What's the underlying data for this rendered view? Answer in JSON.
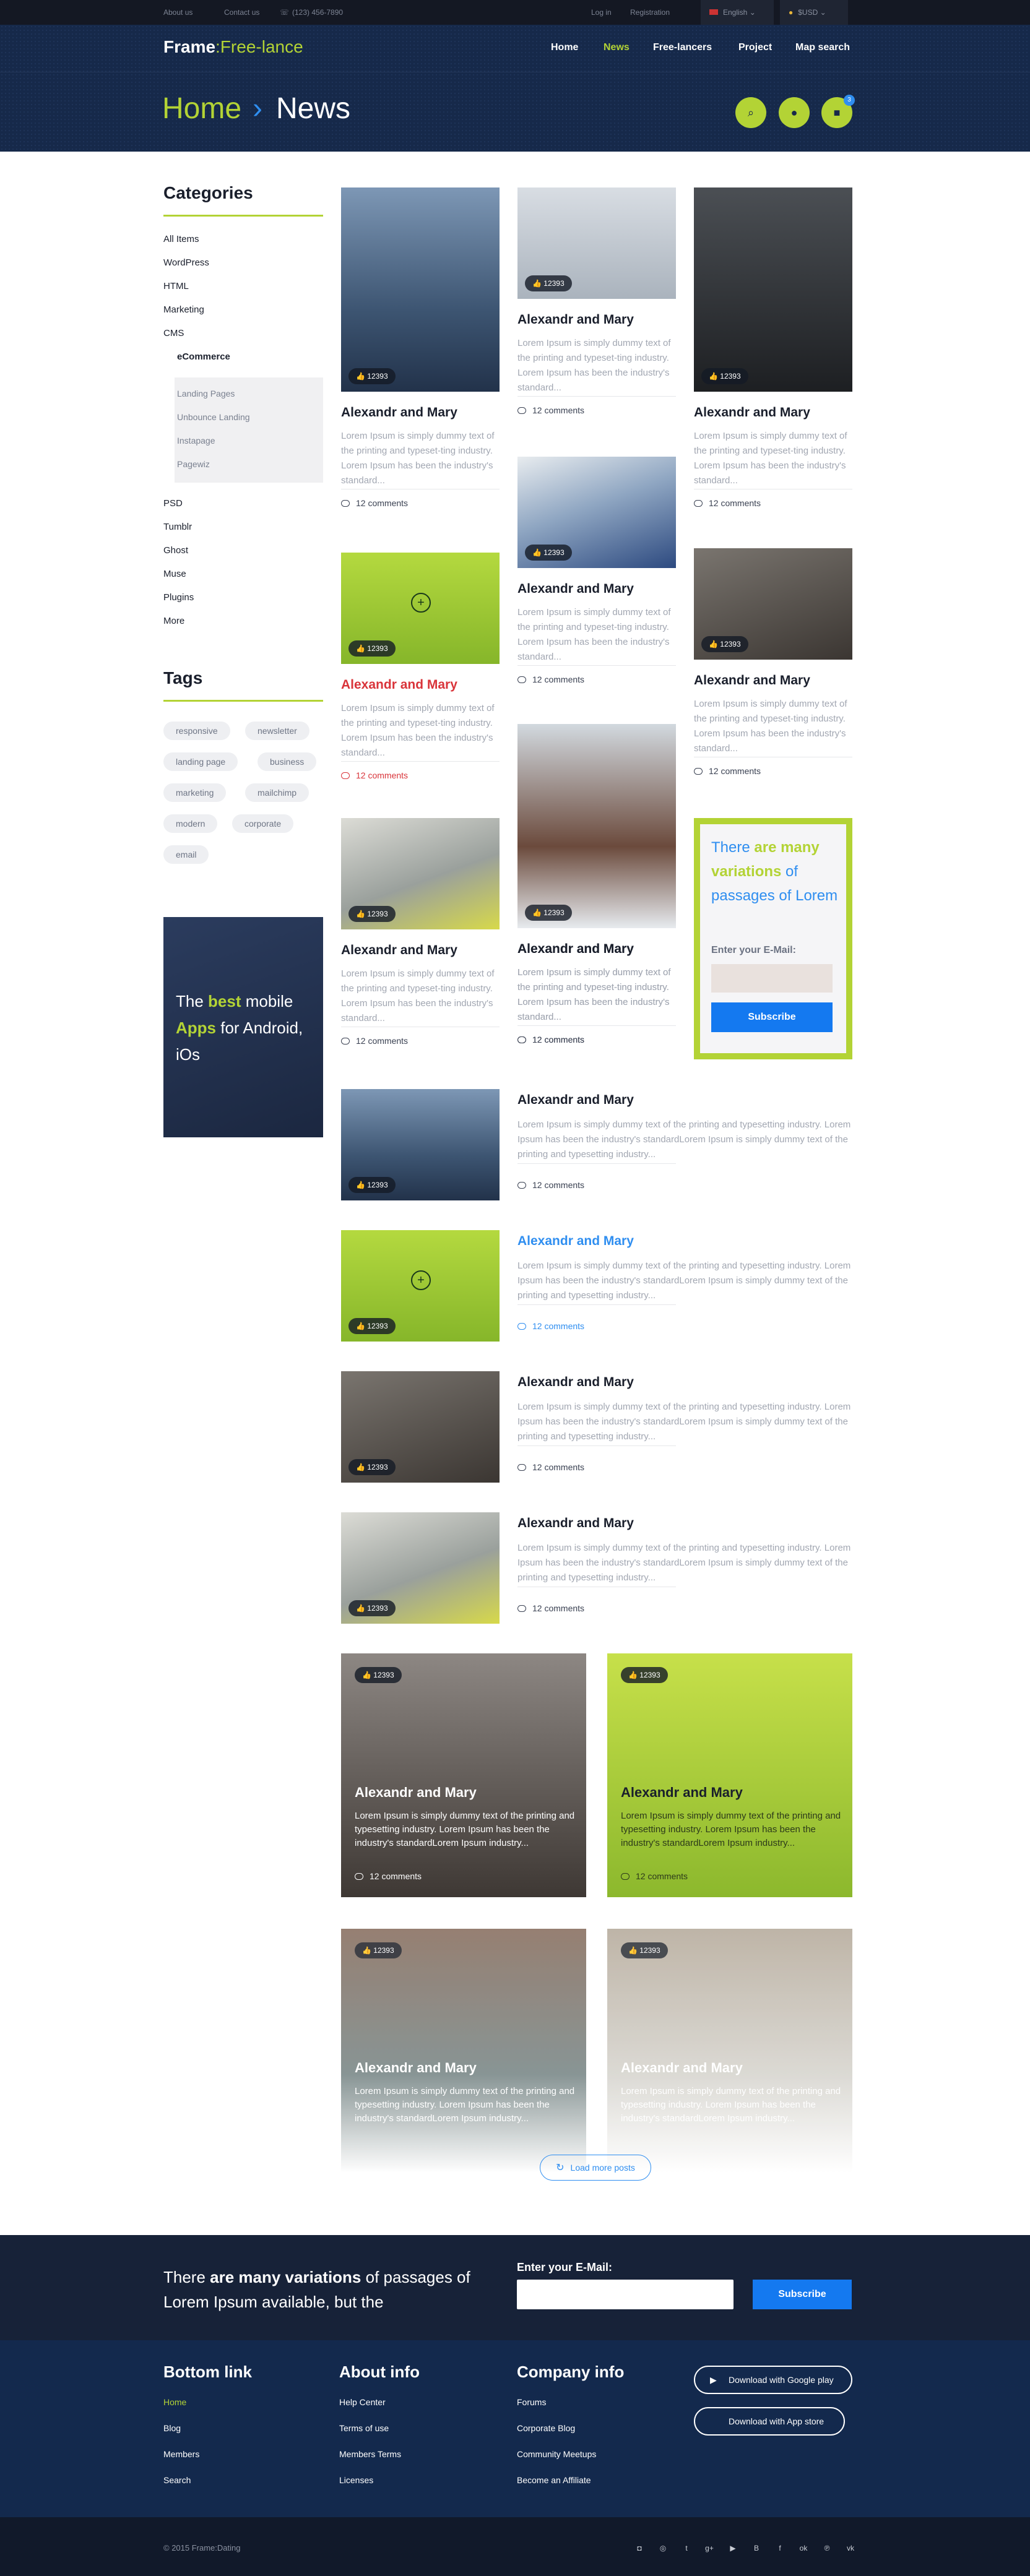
{
  "topbar": {
    "about": "About us",
    "contact": "Contact us",
    "phone": "(123) 456-7890",
    "login": "Log in",
    "registration": "Registration",
    "language": "English",
    "currency": "$USD"
  },
  "header": {
    "logo_a": "Frame",
    "logo_b": ":Free-lance",
    "nav": [
      "Home",
      "News",
      "Free-lancers",
      "Project",
      "Map search"
    ],
    "crumb_home": "Home",
    "crumb_sep": "›",
    "crumb_current": "News",
    "cart_badge": "3"
  },
  "sidebar": {
    "categories_title": "Categories",
    "categories": [
      "All Items",
      "WordPress",
      "HTML",
      "Marketing",
      "CMS",
      "eCommerce"
    ],
    "subcategories": [
      "Landing Pages",
      "Unbounce Landing",
      "Instapage",
      "Pagewiz"
    ],
    "categories_more": [
      "PSD",
      "Tumblr",
      "Ghost",
      "Muse",
      "Plugins",
      "More"
    ],
    "tags_title": "Tags",
    "tags": [
      "responsive",
      "newsletter",
      "landing page",
      "business",
      "marketing",
      "mailchimp",
      "modern",
      "corporate",
      "email"
    ],
    "promo_a": "The ",
    "promo_b": "best",
    "promo_c": " mobile ",
    "promo_d": "Apps",
    "promo_e": " for Android, iOs"
  },
  "card": {
    "title": "Alexandr and Mary",
    "text": "Lorem Ipsum is simply dummy text of the printing and typeset-ting industry. Lorem Ipsum has been the industry's standard...",
    "wide_text": "Lorem Ipsum is simply dummy text of the printing and typesetting industry. Lorem Ipsum has been the industry's standardLorem Ipsum is simply dummy text of the printing and typesetting industry...",
    "big_text": "Lorem Ipsum is simply dummy text of the printing and typesetting industry. Lorem Ipsum has been the industry's standardLorem Ipsum industry...",
    "comments": "12 comments",
    "likes": "12393"
  },
  "newsletter_box": {
    "a": "There ",
    "b": "are many variations",
    "c": " of passages of Lorem",
    "label": "Enter your E-Mail:",
    "button": "Subscribe"
  },
  "load_more": "Load more posts",
  "band": {
    "a": "There ",
    "b": "are many variations",
    "c": " of passages of Lorem Ipsum available, but the",
    "label": "Enter your E-Mail:",
    "button": "Subscribe"
  },
  "footer": {
    "col1_title": "Bottom link",
    "col1": [
      "Home",
      "Blog",
      "Members",
      "Search"
    ],
    "col2_title": "About info",
    "col2": [
      "Help Center",
      "Terms of use",
      "Members Terms",
      "Licenses"
    ],
    "col3_title": "Company info",
    "col3": [
      "Forums",
      "Corporate Blog",
      "Community Meetups",
      "Become an Affiliate"
    ],
    "google": "Download with Google play",
    "apple": "Download with App store",
    "copyright": "© 2015 Frame:Dating"
  },
  "colors": {
    "accent": "#b3d335",
    "blue": "#2f8ef0",
    "navy": "#16294a",
    "red": "#d9343a"
  }
}
